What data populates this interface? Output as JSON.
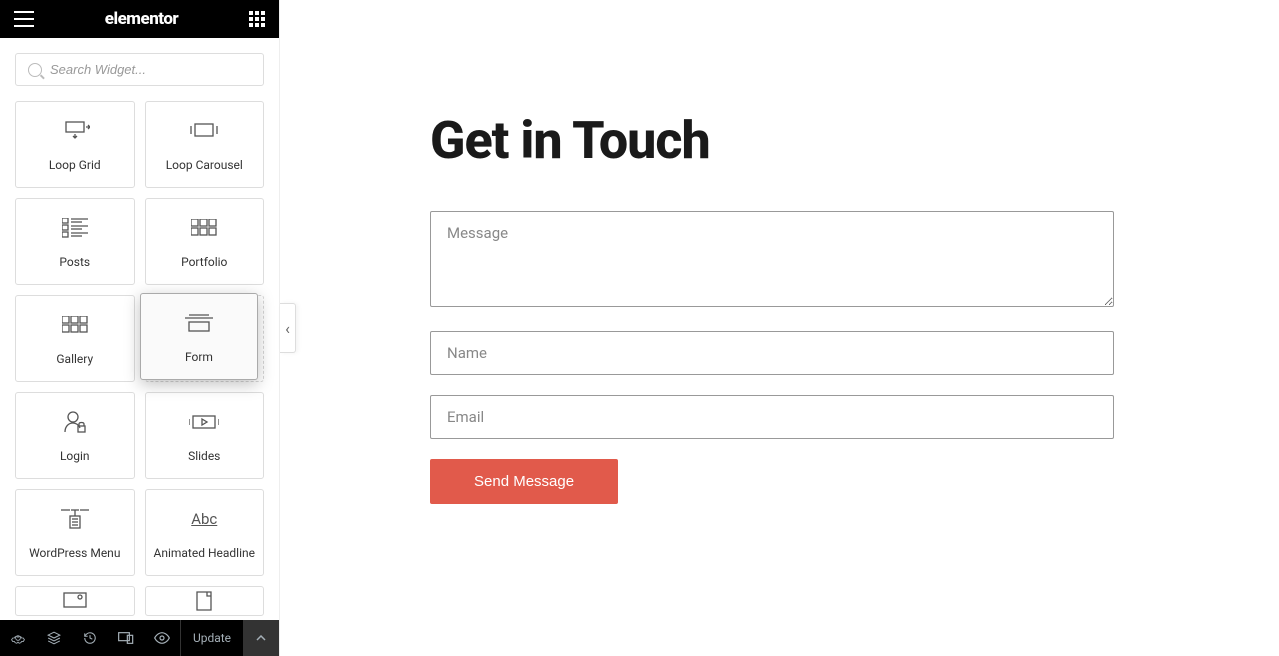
{
  "header": {
    "brand": "elementor"
  },
  "search": {
    "placeholder": "Search Widget..."
  },
  "widgets": [
    {
      "id": "loop-grid",
      "label": "Loop Grid"
    },
    {
      "id": "loop-carousel",
      "label": "Loop Carousel"
    },
    {
      "id": "posts",
      "label": "Posts"
    },
    {
      "id": "portfolio",
      "label": "Portfolio"
    },
    {
      "id": "gallery",
      "label": "Gallery"
    },
    {
      "id": "form",
      "label": "Form"
    },
    {
      "id": "login",
      "label": "Login"
    },
    {
      "id": "slides",
      "label": "Slides"
    },
    {
      "id": "wordpress-menu",
      "label": "WordPress Menu"
    },
    {
      "id": "animated-headline",
      "label": "Animated Headline"
    }
  ],
  "dragging_widget": {
    "label": "Form"
  },
  "footer": {
    "update_label": "Update"
  },
  "canvas": {
    "form": {
      "title": "Get in Touch",
      "message_placeholder": "Message",
      "name_placeholder": "Name",
      "email_placeholder": "Email",
      "submit_label": "Send Message"
    }
  },
  "colors": {
    "header_bg": "#000000",
    "submit_bg": "#e15a4b"
  }
}
